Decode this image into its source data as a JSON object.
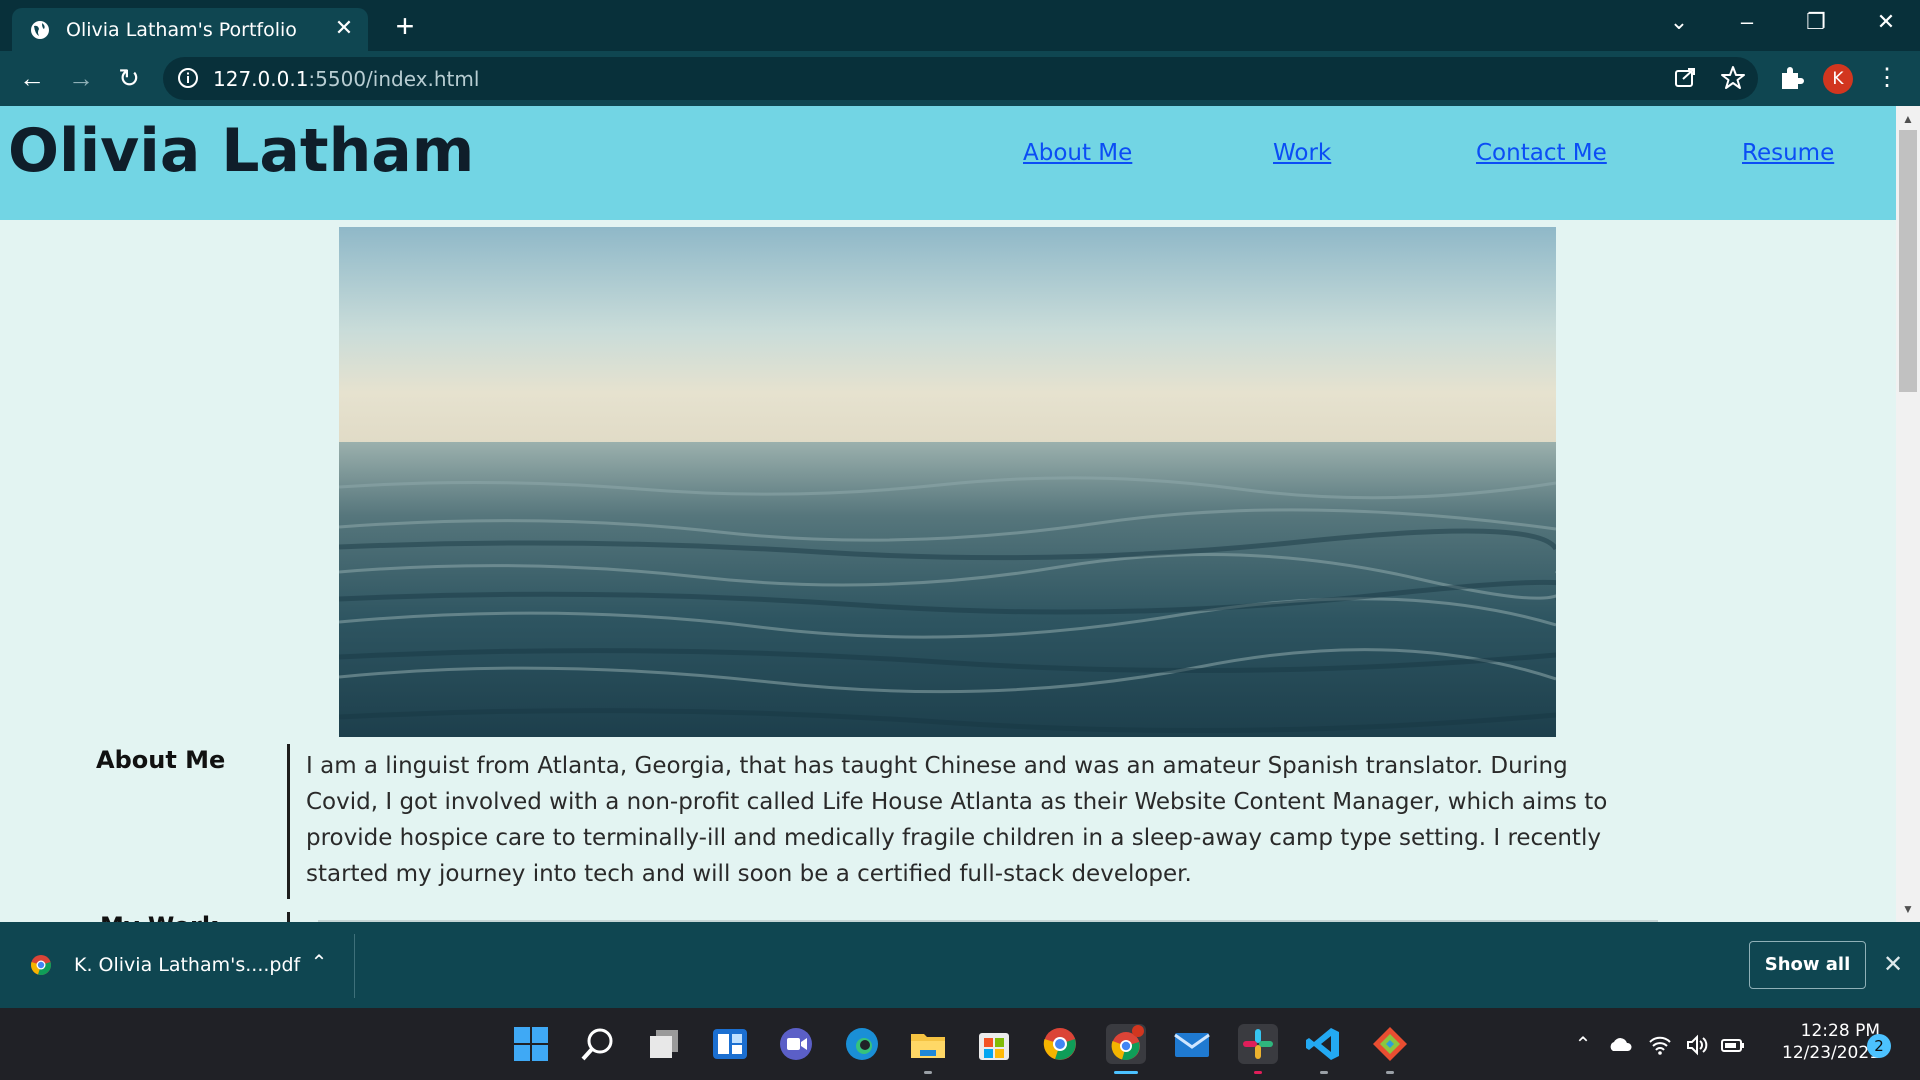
{
  "browser": {
    "tab_title": "Olivia Latham's Portfolio",
    "url_host": "127.0.0.1",
    "url_path": ":5500/index.html",
    "profile_initial": "K",
    "accent": "#0f4651"
  },
  "site": {
    "title": "Olivia Latham",
    "nav": [
      "About Me",
      "Work",
      "Contact Me",
      "Resume"
    ],
    "header_color": "#72d5e4",
    "link_color": "#0b4df5",
    "about_label": "About Me",
    "work_label": "My Work",
    "about_text": "I am a linguist from Atlanta, Georgia, that has taught Chinese and was an amateur Spanish translator. During Covid, I got involved with a non-profit called Life House Atlanta as their Website Content Manager, which aims to provide hospice care to terminally-ill and medically fragile children in a sleep-away camp type setting. I recently started my journey into tech and will soon be a certified full-stack developer."
  },
  "downloads": {
    "file_name": "K. Olivia Latham's....pdf",
    "show_all": "Show all"
  },
  "taskbar": {
    "time": "12:28 PM",
    "date": "12/23/2021",
    "notification_count": "2"
  }
}
